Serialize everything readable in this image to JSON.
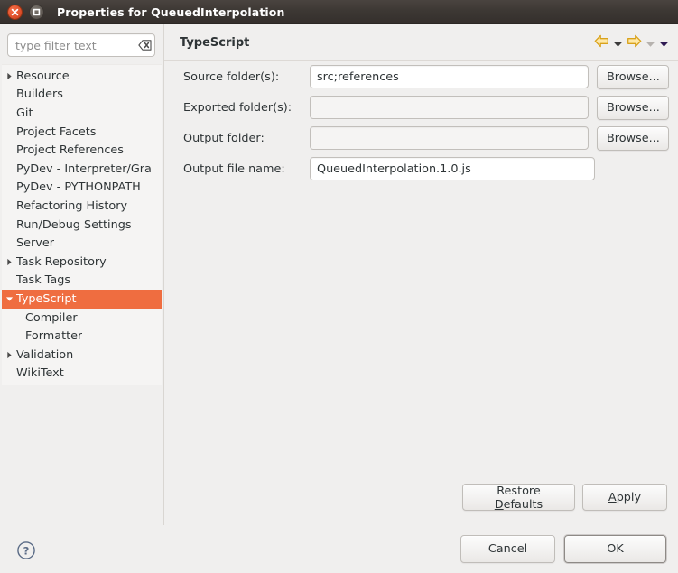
{
  "titlebar": {
    "title": "Properties for QueuedInterpolation",
    "close_icon": "close-icon",
    "maximize_icon": "maximize-icon"
  },
  "sidebar": {
    "filter": {
      "value": "",
      "placeholder": "type filter text",
      "clear_icon": "clear-text-icon"
    },
    "items": [
      {
        "label": "Resource",
        "twisty": "collapsed",
        "indent": 0,
        "selected": false
      },
      {
        "label": "Builders",
        "twisty": "none",
        "indent": 0,
        "selected": false
      },
      {
        "label": "Git",
        "twisty": "none",
        "indent": 0,
        "selected": false
      },
      {
        "label": "Project Facets",
        "twisty": "none",
        "indent": 0,
        "selected": false
      },
      {
        "label": "Project References",
        "twisty": "none",
        "indent": 0,
        "selected": false
      },
      {
        "label": "PyDev - Interpreter/Gra",
        "twisty": "none",
        "indent": 0,
        "selected": false
      },
      {
        "label": "PyDev - PYTHONPATH",
        "twisty": "none",
        "indent": 0,
        "selected": false
      },
      {
        "label": "Refactoring History",
        "twisty": "none",
        "indent": 0,
        "selected": false
      },
      {
        "label": "Run/Debug Settings",
        "twisty": "none",
        "indent": 0,
        "selected": false
      },
      {
        "label": "Server",
        "twisty": "none",
        "indent": 0,
        "selected": false
      },
      {
        "label": "Task Repository",
        "twisty": "collapsed",
        "indent": 0,
        "selected": false
      },
      {
        "label": "Task Tags",
        "twisty": "none",
        "indent": 0,
        "selected": false
      },
      {
        "label": "TypeScript",
        "twisty": "expanded",
        "indent": 0,
        "selected": true
      },
      {
        "label": "Compiler",
        "twisty": "none",
        "indent": 1,
        "selected": false
      },
      {
        "label": "Formatter",
        "twisty": "none",
        "indent": 1,
        "selected": false
      },
      {
        "label": "Validation",
        "twisty": "collapsed",
        "indent": 0,
        "selected": false
      },
      {
        "label": "WikiText",
        "twisty": "none",
        "indent": 0,
        "selected": false
      }
    ]
  },
  "page": {
    "title": "TypeScript",
    "nav": [
      {
        "icon": "back-arrow-icon",
        "state": "enabled"
      },
      {
        "icon": "back-dropdown-icon",
        "state": "enabled"
      },
      {
        "icon": "forward-arrow-icon",
        "state": "enabled"
      },
      {
        "icon": "forward-dropdown-icon",
        "state": "disabled"
      },
      {
        "icon": "menu-dropdown-icon",
        "state": "enabled"
      }
    ],
    "fields": [
      {
        "label": "Source folder(s):",
        "value": "src;references",
        "enabled": true,
        "browse": "Browse...",
        "has_browse": true
      },
      {
        "label": "Exported folder(s):",
        "value": "",
        "enabled": false,
        "browse": "Browse...",
        "has_browse": true
      },
      {
        "label": "Output folder:",
        "value": "",
        "enabled": false,
        "browse": "Browse...",
        "has_browse": true
      },
      {
        "label": "Output file name:",
        "value": "QueuedInterpolation.1.0.js",
        "enabled": true,
        "browse": "",
        "has_browse": false
      }
    ],
    "restore_defaults_label": "Restore Defaults",
    "restore_defaults_mnemonic": "D",
    "apply_label": "Apply",
    "apply_mnemonic": "A"
  },
  "footer": {
    "help_icon": "help-icon",
    "cancel_label": "Cancel",
    "ok_label": "OK"
  },
  "colors": {
    "selection": "#ef6d40",
    "titlebar": "#3d3834",
    "dialog_bg": "#f0efee",
    "tree_bg": "#f5f4f3",
    "arrow_gold": "#e8a317",
    "arrow_gold_fill": "#ffe680"
  }
}
